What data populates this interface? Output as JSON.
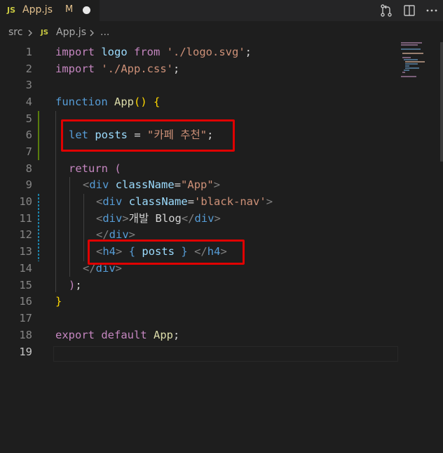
{
  "tab": {
    "icon": "JS",
    "filename": "App.js",
    "modified": "M"
  },
  "toolbar_icons": [
    "source-control-compare-icon",
    "split-editor-icon",
    "more-actions-icon"
  ],
  "breadcrumb": {
    "folder": "src",
    "icon": "JS",
    "file": "App.js",
    "more": "..."
  },
  "code": {
    "line_numbers": [
      "1",
      "2",
      "3",
      "4",
      "5",
      "6",
      "7",
      "8",
      "9",
      "10",
      "11",
      "12",
      "13",
      "14",
      "15",
      "16",
      "17",
      "18",
      "19"
    ],
    "l1_import": "import",
    "l1_logo": "logo",
    "l1_from": "from",
    "l1_path": "'./logo.svg'",
    "l1_semi": ";",
    "l2_import": "import",
    "l2_path": "'./App.css'",
    "l2_semi": ";",
    "l4_function": "function",
    "l4_name": "App",
    "l4_paren": "()",
    "l4_brace": "{",
    "l6_let": "let",
    "l6_var": "posts",
    "l6_eq": "=",
    "l6_str": "\"카페 추천\"",
    "l6_semi": ";",
    "l8_return": "return",
    "l8_paren": "(",
    "l9_open": "<",
    "l9_tag": "div",
    "l9_attr": "className",
    "l9_eq": "=",
    "l9_val": "\"App\"",
    "l9_close": ">",
    "l10_open": "<",
    "l10_tag": "div",
    "l10_attr": "className",
    "l10_eq": "=",
    "l10_val": "'black-nav'",
    "l10_close": ">",
    "l11_open": "<",
    "l11_tag": "div",
    "l11_close": ">",
    "l11_text": "개발 Blog",
    "l11_endopen": "</",
    "l11_endtag": "div",
    "l11_endclose": ">",
    "l12_open": "</",
    "l12_tag": "div",
    "l12_close": ">",
    "l13_open": "<",
    "l13_tag": "h4",
    "l13_close": ">",
    "l13_lb": "{",
    "l13_var": "posts",
    "l13_rb": "}",
    "l13_endopen": "</",
    "l13_endtag": "h4",
    "l13_endclose": ">",
    "l14_open": "</",
    "l14_tag": "div",
    "l14_close": ">",
    "l15_paren": ")",
    "l15_semi": ";",
    "l16_brace": "}",
    "l18_export": "export",
    "l18_default": "default",
    "l18_name": "App",
    "l18_semi": ";"
  },
  "colors": {
    "background": "#1e1e1e",
    "keyword": "#c586c0",
    "string": "#ce9178",
    "function": "#dcdcaa",
    "variable": "#9cdcfe",
    "declaration": "#569cd6",
    "highlight_box": "#e00000",
    "modified_gutter": "#587c0c"
  }
}
